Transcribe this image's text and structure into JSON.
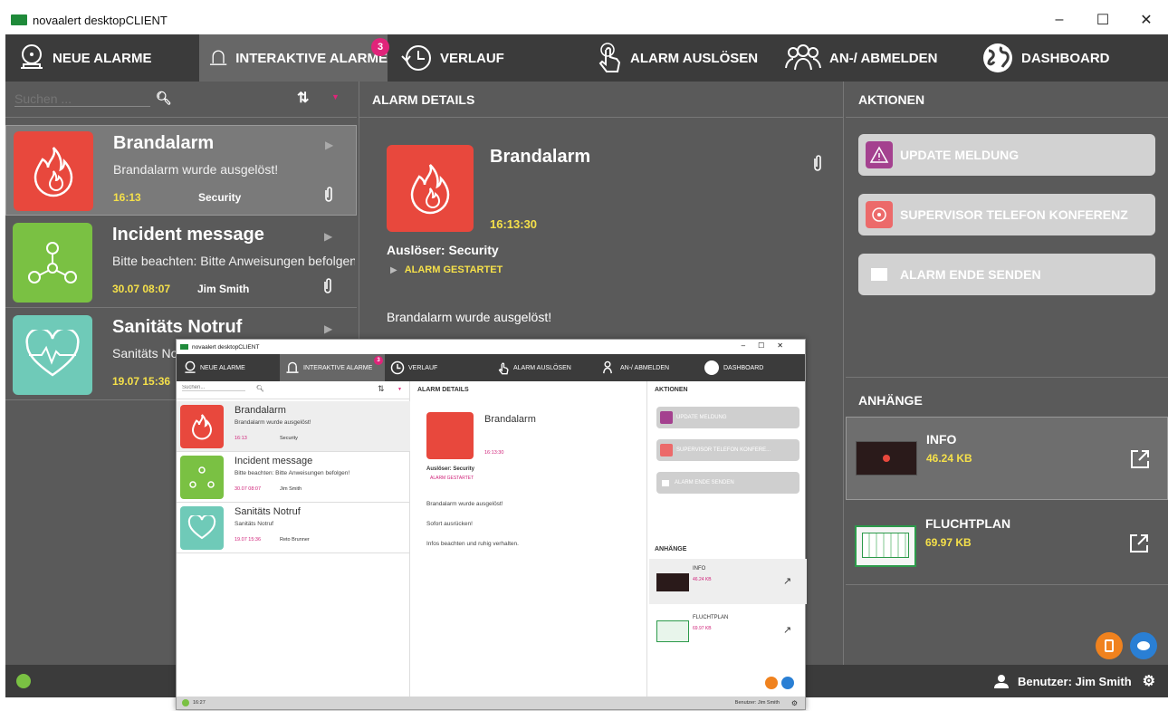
{
  "window": {
    "title": "novaalert desktopCLIENT",
    "controls": {
      "minimize": "–",
      "maximize": "☐",
      "close": "✕"
    }
  },
  "nav": {
    "neue_alarme": "NEUE ALARME",
    "interaktive_alarme": "INTERAKTIVE ALARME",
    "interaktive_badge": "3",
    "verlauf": "VERLAUF",
    "alarm_ausloesen": "ALARM AUSLÖSEN",
    "an_abmelden": "AN-/ ABMELDEN",
    "dashboard": "DASHBOARD"
  },
  "list": {
    "search_placeholder": "Suchen ...",
    "items": [
      {
        "title": "Brandalarm",
        "desc": "Brandalarm wurde ausgelöst!",
        "time": "16:13",
        "user": "Security",
        "color": "#e8483d",
        "icon": "fire-icon"
      },
      {
        "title": "Incident message",
        "desc": "Bitte beachten: Bitte Anweisungen befolgen!",
        "time": "30.07  08:07",
        "user": "Jim Smith",
        "color": "#7ac143",
        "icon": "network-icon"
      },
      {
        "title": "Sanitäts Notruf",
        "desc": "Sanitäts Notruf",
        "time": "19.07  15:36",
        "user": "",
        "color": "#6fcab8",
        "icon": "heart-pulse-icon"
      }
    ]
  },
  "details": {
    "header": "ALARM DETAILS",
    "title": "Brandalarm",
    "time": "16:13:30",
    "trigger": "Auslöser: Security",
    "status": "ALARM GESTARTET",
    "message": "Brandalarm wurde ausgelöst!"
  },
  "actions": {
    "header": "AKTIONEN",
    "update": "UPDATE MELDUNG",
    "supervisor": "SUPERVISOR TELEFON KONFERENZ",
    "end": "ALARM ENDE SENDEN"
  },
  "attachments": {
    "header": "ANHÄNGE",
    "items": [
      {
        "name": "INFO",
        "size": "46.24 KB"
      },
      {
        "name": "FLUCHTPLAN",
        "size": "69.97 KB"
      }
    ]
  },
  "status": {
    "user": "Benutzer: Jim Smith"
  },
  "small": {
    "title": "novaalert desktopCLIENT",
    "search_placeholder": "Suchen...",
    "items": [
      {
        "title": "Brandalarm",
        "desc": "Brandalarm wurde ausgelöst!",
        "time": "16:13",
        "user": "Security"
      },
      {
        "title": "Incident message",
        "desc": "Bitte beachten: Bitte Anweisungen befolgen!",
        "time": "30.07  08:07",
        "user": "Jim Smith"
      },
      {
        "title": "Sanitäts Notruf",
        "desc": "Sanitäts Notruf",
        "time": "19.07  15:36",
        "user": "Reto Brunner"
      }
    ],
    "details": {
      "title": "Brandalarm",
      "time": "16:13:30",
      "trigger": "Auslöser: Security",
      "status": "ALARM GESTARTET",
      "lines": [
        "Brandalarm wurde ausgelöst!",
        "Sofort ausrücken!",
        "Infos beachten und ruhig verhalten."
      ]
    },
    "actions": {
      "supervisor": "SUPERVISOR TELEFON KONFERE..."
    },
    "status_time": "16:27"
  }
}
